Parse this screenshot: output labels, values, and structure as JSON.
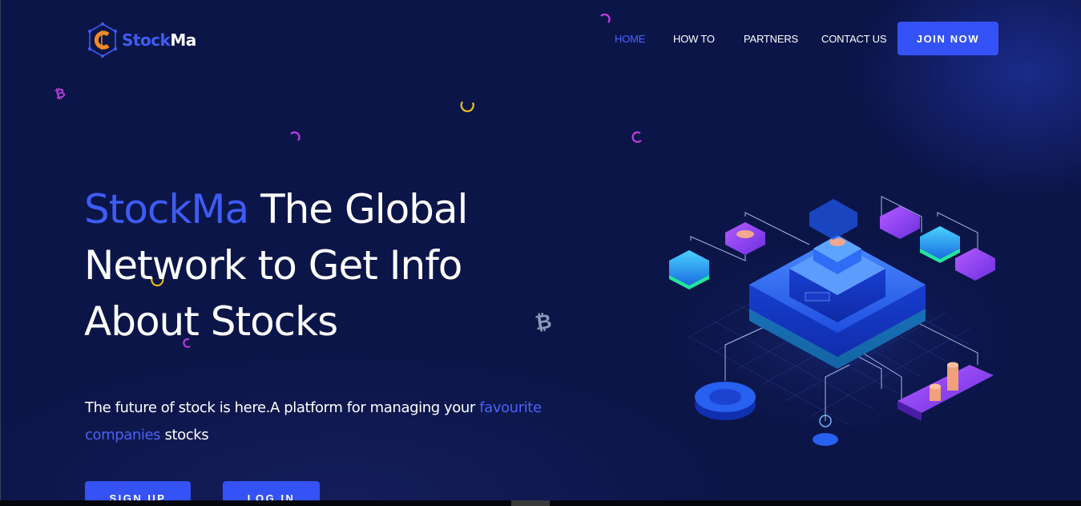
{
  "brand": {
    "logo_letter": "C",
    "name_part1": "Stock",
    "name_part2": "Ma",
    "colors": {
      "primary": "#3e5cf5",
      "background": "#0c1548",
      "accent_orange": "#f08a24",
      "accent_purple": "#a332e0"
    }
  },
  "nav": {
    "items": [
      {
        "label": "HOME",
        "active": true
      },
      {
        "label": "HOW TO",
        "active": false
      },
      {
        "label": "PARTNERS",
        "active": false
      },
      {
        "label": "CONTACT US",
        "active": false
      }
    ],
    "cta": "JOIN NOW"
  },
  "hero": {
    "title_brand": "StockMa",
    "title_rest_line1": " The Global",
    "title_line2": "Network to Get Info",
    "title_line3": "About Stocks",
    "subtitle_part1": "The future of stock is here.A platform for managing your ",
    "subtitle_highlight": "favourite companies",
    "subtitle_part2": " stocks",
    "signup_label": "SIGN UP",
    "login_label": "LOG IN"
  },
  "icons": {
    "logo": "hexagon-circuit-coin-icon",
    "bitcoin": "bitcoin-icon",
    "illustration": "isometric-blockchain-network-illustration"
  }
}
